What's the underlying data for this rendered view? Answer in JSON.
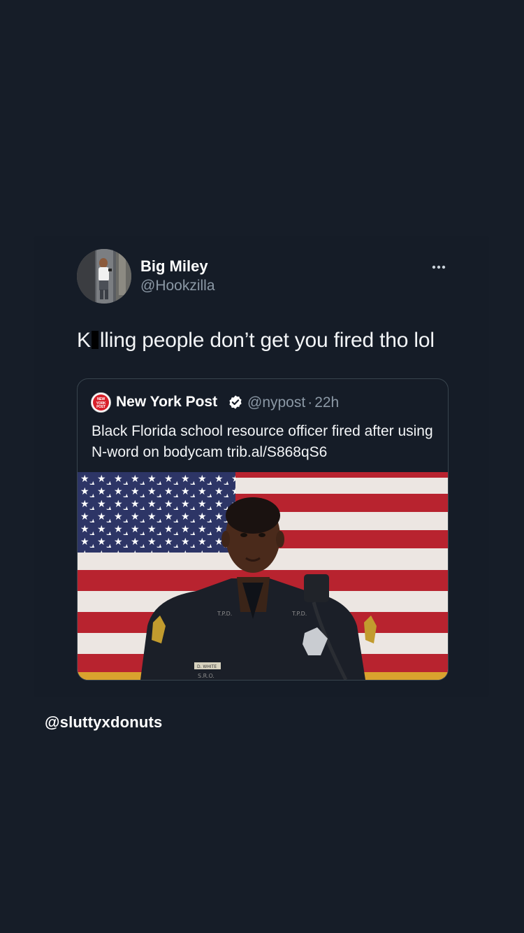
{
  "tweet": {
    "display_name": "Big Miley",
    "handle": "@Hookzilla",
    "avatar_icon": "user-avatar-photo",
    "more_icon": "more-horizontal-icon",
    "text_prefix": "K",
    "text_suffix": "lling people don’t get you fired tho lol",
    "redaction_color": "#000000"
  },
  "quote": {
    "logo_text": "NEW YORK POST",
    "name": "New York Post",
    "verified_icon": "verified-badge-icon",
    "handle": "@nypost",
    "separator": "·",
    "time": "22h",
    "text": "Black Florida school resource officer fired after using N-word on bodycam trib.al/S868qS6",
    "image_icon": "officer-portrait-flag-photo",
    "name_tag": "D. WHITE",
    "collar_badge": "T.P.D.",
    "pocket_text": "S.R.O."
  },
  "watermark": "@sluttyxdonuts",
  "colors": {
    "background": "#161d28",
    "card_border": "#38444d",
    "secondary_text": "#8b98a5",
    "verified": "#ffffff",
    "nyp_red": "#d8202a"
  }
}
